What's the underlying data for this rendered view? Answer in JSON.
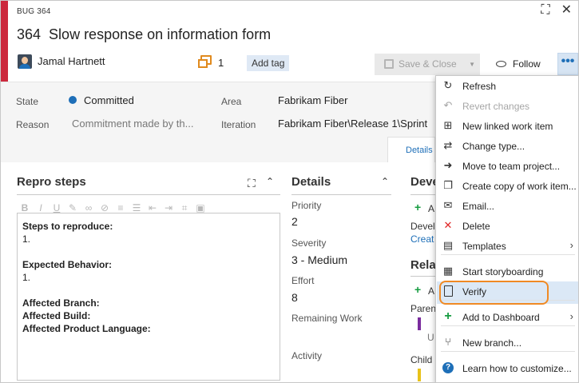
{
  "header": {
    "type_label": "BUG 364",
    "id": "364",
    "title": "Slow response on information form",
    "assignee": "Jamal Hartnett",
    "comment_count": "1",
    "add_tag": "Add tag",
    "save_close": "Save & Close",
    "follow": "Follow",
    "more": "•••",
    "stripe_color": "#cc293d"
  },
  "fields": {
    "state_label": "State",
    "state_value": "Committed",
    "reason_label": "Reason",
    "reason_value": "Commitment made by th...",
    "area_label": "Area",
    "area_value": "Fabrikam Fiber",
    "iteration_label": "Iteration",
    "iteration_value": "Fabrikam Fiber\\Release 1\\Sprint"
  },
  "tabs": {
    "details": "Details"
  },
  "repro": {
    "title": "Repro steps",
    "lines": [
      {
        "text": "Steps to reproduce:",
        "bold": true
      },
      {
        "text": "1.",
        "bold": false
      },
      {
        "text": "",
        "bold": false
      },
      {
        "text": "Expected Behavior:",
        "bold": true
      },
      {
        "text": "1.",
        "bold": false
      },
      {
        "text": "",
        "bold": false
      },
      {
        "text": "Affected Branch:",
        "bold": true
      },
      {
        "text": "Affected Build:",
        "bold": true
      },
      {
        "text": "Affected Product Language:",
        "bold": true
      }
    ]
  },
  "details": {
    "title": "Details",
    "priority_label": "Priority",
    "priority_value": "2",
    "severity_label": "Severity",
    "severity_value": "3 - Medium",
    "effort_label": "Effort",
    "effort_value": "8",
    "remaining_label": "Remaining Work",
    "activity_label": "Activity"
  },
  "development": {
    "title": "Devel",
    "add": "A",
    "text": "Devel",
    "link": "Creat"
  },
  "related": {
    "title": "Rela",
    "add": "A",
    "parent_label": "Paren",
    "parent_sub": "U",
    "child_label": "Child"
  },
  "menu": {
    "items": [
      {
        "label": "Refresh",
        "icon": "refresh-icon",
        "glyph": "↻",
        "disabled": false
      },
      {
        "label": "Revert changes",
        "icon": "undo-icon",
        "glyph": "↶",
        "disabled": true
      },
      {
        "label": "New linked work item",
        "icon": "new-linked-item-icon",
        "glyph": "⊞",
        "disabled": false
      },
      {
        "label": "Change type...",
        "icon": "swap-icon",
        "glyph": "⇄",
        "disabled": false
      },
      {
        "label": "Move to team project...",
        "icon": "move-icon",
        "glyph": "➜",
        "disabled": false
      },
      {
        "label": "Create copy of work item...",
        "icon": "copy-icon",
        "glyph": "❐",
        "disabled": false
      },
      {
        "label": "Email...",
        "icon": "email-icon",
        "glyph": "✉",
        "disabled": false
      },
      {
        "label": "Delete",
        "icon": "delete-icon",
        "glyph": "✕",
        "disabled": false
      },
      {
        "label": "Templates",
        "icon": "templates-icon",
        "glyph": "▤",
        "disabled": false
      },
      {
        "label": "Start storyboarding",
        "icon": "storyboard-icon",
        "glyph": "▦",
        "disabled": false
      },
      {
        "label": "Verify",
        "icon": "verify-document-icon",
        "glyph": "",
        "disabled": false
      },
      {
        "label": "Add to Dashboard",
        "icon": "plus-icon",
        "glyph": "+",
        "disabled": false
      },
      {
        "label": "New branch...",
        "icon": "branch-icon",
        "glyph": "⑂",
        "disabled": false
      },
      {
        "label": "Learn how to customize...",
        "icon": "help-icon",
        "glyph": "?",
        "disabled": false
      }
    ]
  },
  "colors": {
    "accent": "#1e6fb8",
    "highlight_ring": "#f08a24",
    "delete": "#e02424",
    "plus": "#169c41",
    "parent_bar": "#7a2c9e",
    "child_bar": "#e8c21a"
  }
}
